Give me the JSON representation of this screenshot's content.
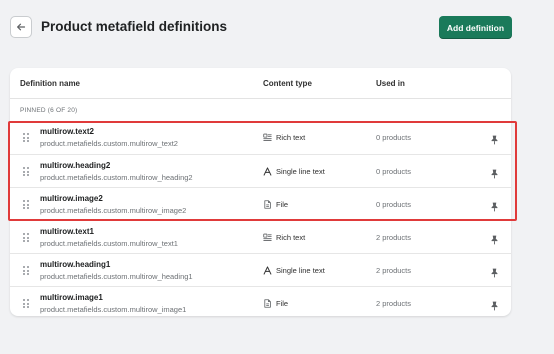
{
  "header": {
    "title": "Product metafield definitions",
    "add_button_label": "Add definition"
  },
  "colors": {
    "primary": "#1a7a5a",
    "highlight": "#e03a3a",
    "background": "#f1f2f4"
  },
  "table": {
    "columns": {
      "name": "Definition name",
      "content_type": "Content type",
      "used_in": "Used in"
    },
    "section_label": "PINNED (6 OF 20)",
    "rows": [
      {
        "name": "multirow.text2",
        "key": "product.metafields.custom.multirow_text2",
        "content_type": "Rich text",
        "icon": "rich-text-icon",
        "used_in": "0 products"
      },
      {
        "name": "multirow.heading2",
        "key": "product.metafields.custom.multirow_heading2",
        "content_type": "Single line text",
        "icon": "text-icon",
        "used_in": "0 products"
      },
      {
        "name": "multirow.image2",
        "key": "product.metafields.custom.multirow_image2",
        "content_type": "File",
        "icon": "file-icon",
        "used_in": "0 products"
      },
      {
        "name": "multirow.text1",
        "key": "product.metafields.custom.multirow_text1",
        "content_type": "Rich text",
        "icon": "rich-text-icon",
        "used_in": "2 products"
      },
      {
        "name": "multirow.heading1",
        "key": "product.metafields.custom.multirow_heading1",
        "content_type": "Single line text",
        "icon": "text-icon",
        "used_in": "2 products"
      },
      {
        "name": "multirow.image1",
        "key": "product.metafields.custom.multirow_image1",
        "content_type": "File",
        "icon": "file-icon",
        "used_in": "2 products"
      }
    ]
  }
}
